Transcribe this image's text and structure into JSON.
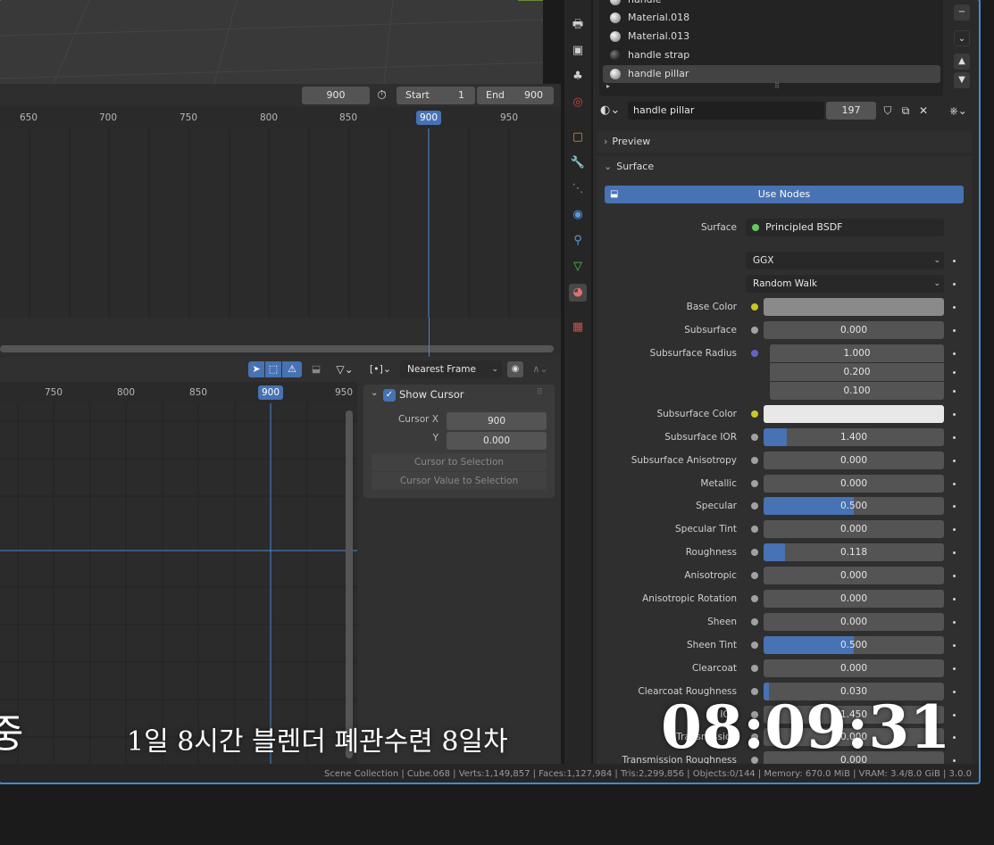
{
  "viewport": {},
  "timeline": {
    "current_frame": "900",
    "start_label": "Start",
    "start_value": "1",
    "end_label": "End",
    "end_value": "900",
    "ruler": [
      "650",
      "700",
      "750",
      "800",
      "850",
      "900",
      "950"
    ],
    "marker": "900"
  },
  "graph_editor": {
    "ruler": [
      "750",
      "800",
      "850",
      "900",
      "950"
    ],
    "marker": "900",
    "snap_mode": "Nearest Frame",
    "panel_title": "Show Cursor",
    "cursor_x_label": "Cursor X",
    "cursor_x_value": "900",
    "y_label": "Y",
    "y_value": "0.000",
    "cursor_to_selection": "Cursor to Selection",
    "cursor_value_to_selection": "Cursor Value to Selection"
  },
  "material_slots": [
    {
      "name": "handle",
      "dark": false
    },
    {
      "name": "Material.018",
      "dark": false
    },
    {
      "name": "Material.013",
      "dark": false
    },
    {
      "name": "handle strap",
      "dark": true
    },
    {
      "name": "handle pillar",
      "dark": false,
      "selected": true
    }
  ],
  "material": {
    "name": "handle pillar",
    "users": "197"
  },
  "panels": {
    "preview": "Preview",
    "surface": "Surface",
    "use_nodes": "Use Nodes",
    "surface_label": "Surface",
    "surface_shader": "Principled BSDF",
    "distribution": "GGX",
    "subsurface_method": "Random Walk"
  },
  "properties": [
    {
      "label": "Base Color",
      "type": "color",
      "color": "#8a8a8a",
      "socket": "yellow"
    },
    {
      "label": "Subsurface",
      "value": "0.000",
      "fill": 0
    },
    {
      "label": "Subsurface Radius",
      "type": "vector",
      "values": [
        "1.000",
        "0.200",
        "0.100"
      ],
      "socket": "purple"
    },
    {
      "label": "Subsurface Color",
      "type": "color",
      "color": "#e8e8e8",
      "socket": "yellow"
    },
    {
      "label": "Subsurface IOR",
      "value": "1.400",
      "fill": 0.13
    },
    {
      "label": "Subsurface Anisotropy",
      "value": "0.000",
      "fill": 0
    },
    {
      "label": "Metallic",
      "value": "0.000",
      "fill": 0
    },
    {
      "label": "Specular",
      "value": "0.500",
      "fill": 0.5
    },
    {
      "label": "Specular Tint",
      "value": "0.000",
      "fill": 0
    },
    {
      "label": "Roughness",
      "value": "0.118",
      "fill": 0.118
    },
    {
      "label": "Anisotropic",
      "value": "0.000",
      "fill": 0
    },
    {
      "label": "Anisotropic Rotation",
      "value": "0.000",
      "fill": 0
    },
    {
      "label": "Sheen",
      "value": "0.000",
      "fill": 0
    },
    {
      "label": "Sheen Tint",
      "value": "0.500",
      "fill": 0.5
    },
    {
      "label": "Clearcoat",
      "value": "0.000",
      "fill": 0
    },
    {
      "label": "Clearcoat Roughness",
      "value": "0.030",
      "fill": 0.03
    },
    {
      "label": "IOR",
      "value": "1.450",
      "fill": 0
    },
    {
      "label": "Transmission",
      "value": "0.000",
      "fill": 0
    },
    {
      "label": "Transmission Roughness",
      "value": "0.000",
      "fill": 0
    }
  ],
  "status_bar": "Scene Collection | Cube.068 | Verts:1,149,857 | Faces:1,127,984 | Tris:2,299,856 | Objects:0/144 | Memory: 670.0 MiB | VRAM: 3.4/8.0 GiB | 3.0.0",
  "overlay": {
    "left_char": "중",
    "caption": "1일 8시간 블렌더 폐관수련 8일차",
    "clock": "08:09:31"
  },
  "colors": {
    "accent": "#4772b3",
    "frame_border": "#4a88cf"
  }
}
